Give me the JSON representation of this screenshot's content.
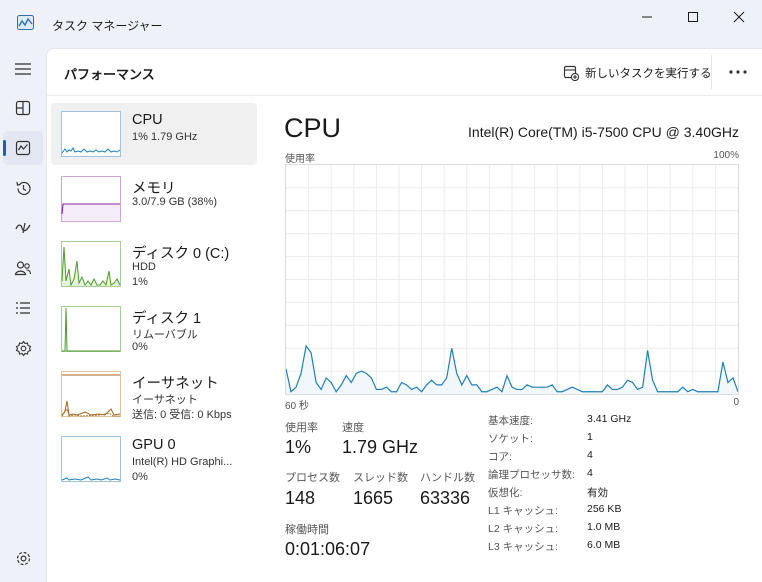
{
  "window": {
    "title": "タスク マネージャー"
  },
  "sidebar": {
    "items": [
      {
        "icon": "hamburger-menu-icon",
        "label": ""
      },
      {
        "icon": "processes-icon",
        "label": ""
      },
      {
        "icon": "performance-icon",
        "label": "",
        "active": true
      },
      {
        "icon": "app-history-icon",
        "label": ""
      },
      {
        "icon": "startup-apps-icon",
        "label": ""
      },
      {
        "icon": "users-icon",
        "label": ""
      },
      {
        "icon": "details-icon",
        "label": ""
      },
      {
        "icon": "services-icon",
        "label": ""
      },
      {
        "icon": "settings-icon",
        "label": ""
      }
    ]
  },
  "header": {
    "title": "パフォーマンス",
    "run_new_task": "新しいタスクを実行する",
    "more": "..."
  },
  "resources": [
    {
      "name": "CPU",
      "line1": "1%  1.79 GHz",
      "line2": "",
      "color": "#1f7fb5"
    },
    {
      "name": "メモリ",
      "line1": "3.0/7.9 GB (38%)",
      "line2": "",
      "color": "#8b1fa8"
    },
    {
      "name": "ディスク 0 (C:)",
      "line1": "HDD",
      "line2": "1%",
      "color": "#4c9a2a"
    },
    {
      "name": "ディスク 1",
      "line1": "リムーバブル",
      "line2": "0%",
      "color": "#4c9a2a"
    },
    {
      "name": "イーサネット",
      "line1": "イーサネット",
      "line2": "送信: 0 受信: 0 Kbps",
      "color": "#a8641b"
    },
    {
      "name": "GPU 0",
      "line1": "Intel(R) HD Graphi...",
      "line2": "0%",
      "color": "#1f7fb5"
    }
  ],
  "detail": {
    "title": "CPU",
    "model": "Intel(R) Core(TM) i5-7500 CPU @ 3.40GHz",
    "graph_label": "使用率",
    "graph_max": "100%",
    "axis_left": "60 秒",
    "axis_right": "0",
    "stats": {
      "utilization_label": "使用率",
      "utilization_value": "1%",
      "speed_label": "速度",
      "speed_value": "1.79 GHz",
      "processes_label": "プロセス数",
      "processes_value": "148",
      "threads_label": "スレッド数",
      "threads_value": "1665",
      "handles_label": "ハンドル数",
      "handles_value": "63336",
      "uptime_label": "稼働時間",
      "uptime_value": "0:01:06:07"
    },
    "specs": [
      {
        "key": "基本速度:",
        "value": "3.41 GHz"
      },
      {
        "key": "ソケット:",
        "value": "1"
      },
      {
        "key": "コア:",
        "value": "4"
      },
      {
        "key": "論理プロセッサ数:",
        "value": "4"
      },
      {
        "key": "仮想化:",
        "value": "有効"
      },
      {
        "key": "L1 キャッシュ:",
        "value": "256 KB"
      },
      {
        "key": "L2 キャッシュ:",
        "value": "1.0 MB"
      },
      {
        "key": "L3 キャッシュ:",
        "value": "6.0 MB"
      }
    ]
  },
  "cpu_usage_history": [
    11,
    1,
    3,
    9,
    21,
    18,
    5,
    2,
    7,
    5,
    1,
    4,
    8,
    5,
    9,
    10,
    9,
    7,
    2,
    2,
    3,
    1,
    1,
    5,
    4,
    2,
    3,
    1,
    4,
    6,
    4,
    4,
    7,
    20,
    9,
    4,
    8,
    4,
    4,
    1,
    1,
    2,
    3,
    1,
    8,
    3,
    2,
    2,
    4,
    3,
    3,
    3,
    3,
    4,
    1,
    1,
    2,
    3,
    2,
    1,
    1,
    1,
    1,
    1,
    4,
    2,
    2,
    3,
    6,
    5,
    2,
    3,
    19,
    6,
    1,
    1,
    1,
    1,
    1,
    3,
    1,
    2,
    1,
    1,
    1,
    1,
    1,
    14,
    5,
    7,
    1
  ],
  "colors": {
    "cpu_line": "#1f7fb5",
    "cpu_fill": "#f1f7fb",
    "grid": "#ebebeb",
    "accent": "#1f5fae"
  }
}
